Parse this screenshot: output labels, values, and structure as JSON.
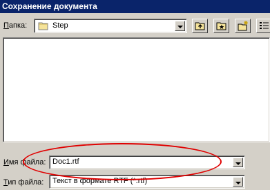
{
  "window": {
    "title": "Сохранение документа"
  },
  "folder": {
    "label": "Папка:",
    "label_accel": "П",
    "label_rest": "апка:",
    "value": "Step"
  },
  "toolbar": {
    "up_icon": "folder-up-icon",
    "favorites_icon": "favorites-folder-icon",
    "new_folder_icon": "new-folder-icon",
    "view_icon": "view-menu-icon"
  },
  "filename": {
    "label": "Имя файла:",
    "label_accel": "И",
    "label_rest": "мя файла:",
    "value": "Doc1.rtf"
  },
  "filetype": {
    "label": "Тип файла:",
    "label_accel": "Т",
    "label_rest": "ип файла:",
    "value": "Текст в формате RTF (*.rtf)"
  },
  "colors": {
    "title_bar": "#0a246a",
    "dialog_bg": "#d4d0c8",
    "annotation": "#e00000"
  }
}
